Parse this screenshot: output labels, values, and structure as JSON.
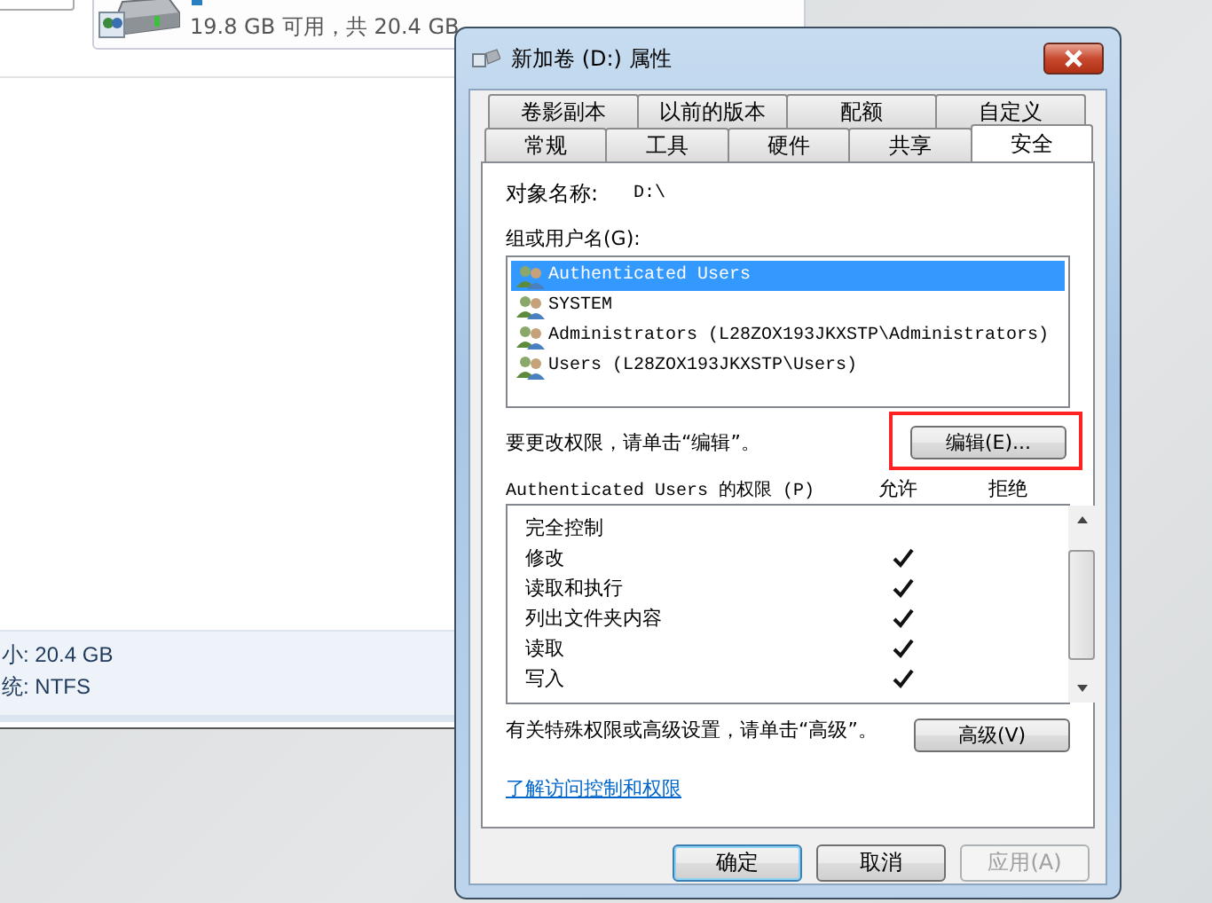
{
  "background_window": {
    "drive_usage": "19.8 GB 可用，共 20.4 GB",
    "details": [
      "小: 20.4 GB",
      "统: NTFS"
    ]
  },
  "dialog": {
    "title": "新加卷 (D:) 属性",
    "tabs_row_1": [
      {
        "label": "卷影副本",
        "selected": false
      },
      {
        "label": "以前的版本",
        "selected": false
      },
      {
        "label": "配额",
        "selected": false
      },
      {
        "label": "自定义",
        "selected": false
      }
    ],
    "tabs_row_2": [
      {
        "label": "常规",
        "selected": false
      },
      {
        "label": "工具",
        "selected": false
      },
      {
        "label": "硬件",
        "selected": false
      },
      {
        "label": "共享",
        "selected": false
      },
      {
        "label": "安全",
        "selected": true
      }
    ],
    "object_name": {
      "label": "对象名称:",
      "value": "D:\\"
    },
    "groups_label": "组或用户名(G):",
    "users": [
      {
        "name": "Authenticated Users",
        "selected": true
      },
      {
        "name": "SYSTEM",
        "selected": false
      },
      {
        "name": "Administrators (L28ZOX193JKXSTP\\Administrators)",
        "selected": false
      },
      {
        "name": "Users (L28ZOX193JKXSTP\\Users)",
        "selected": false
      }
    ],
    "edit_hint": "要更改权限，请单击“编辑”。",
    "edit_button": "编辑(E)...",
    "permissions_label": "Authenticated Users 的权限 (P)",
    "columns": [
      "允许",
      "拒绝"
    ],
    "permissions": [
      {
        "name": "完全控制",
        "allow": false,
        "deny": false
      },
      {
        "name": "修改",
        "allow": true,
        "deny": false
      },
      {
        "name": "读取和执行",
        "allow": true,
        "deny": false
      },
      {
        "name": "列出文件夹内容",
        "allow": true,
        "deny": false
      },
      {
        "name": "读取",
        "allow": true,
        "deny": false
      },
      {
        "name": "写入",
        "allow": true,
        "deny": false
      }
    ],
    "advanced_hint": "有关特殊权限或高级设置，请单击“高级”。",
    "advanced_button": "高级(V)",
    "link": "了解访问控制和权限",
    "buttons": [
      {
        "label": "确定",
        "default": true,
        "disabled": false
      },
      {
        "label": "取消",
        "default": false,
        "disabled": false
      },
      {
        "label": "应用(A)",
        "default": false,
        "disabled": true
      }
    ]
  }
}
